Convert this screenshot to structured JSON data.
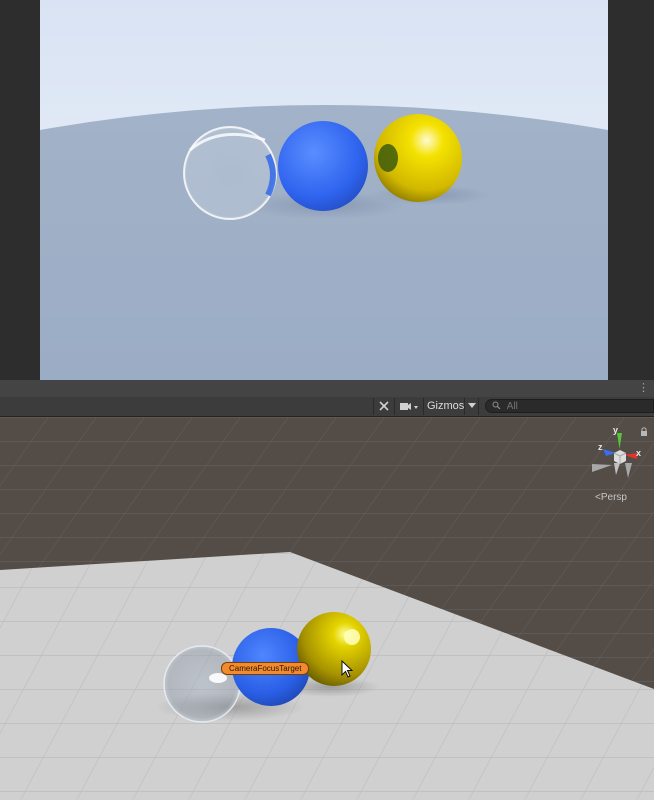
{
  "game_view": {
    "objects": [
      {
        "name": "glass-sphere",
        "material": "glass"
      },
      {
        "name": "blue-sphere",
        "color": "#3a73f5"
      },
      {
        "name": "gold-sphere",
        "color": "#e6cc00"
      }
    ],
    "colors": {
      "sky": "#dfe8f7",
      "floor": "#98a9c2",
      "side_bars": "#2d2d2d"
    }
  },
  "splitter": {
    "menu_icon": "⋮"
  },
  "toolbar": {
    "fx_icon": "effects-icon",
    "camera_icon": "camera-icon",
    "gizmos_label": "Gizmos",
    "gizmos_dropdown_icon": "chevron-down-icon",
    "search_icon": "search-icon",
    "search_placeholder": "All"
  },
  "scene_view": {
    "gizmo": {
      "y_label": "y",
      "x_label": "x",
      "z_label": "z"
    },
    "persp_label": "Persp",
    "focus_target_label": "CameraFocusTarget",
    "colors": {
      "ground": "#554d48",
      "plane": "#cfcfcf",
      "axis_x": "#e0342a",
      "axis_y": "#57c53a",
      "axis_z": "#3a6ee8"
    }
  }
}
